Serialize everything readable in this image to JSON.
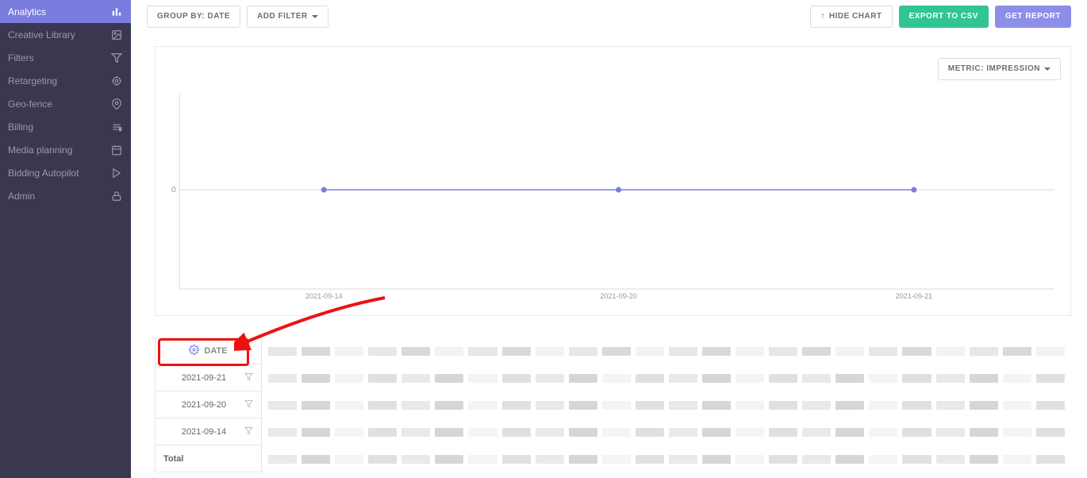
{
  "sidebar": {
    "items": [
      {
        "label": "Analytics",
        "icon": "bar"
      },
      {
        "label": "Creative Library",
        "icon": "image"
      },
      {
        "label": "Filters",
        "icon": "funnel"
      },
      {
        "label": "Retargeting",
        "icon": "target"
      },
      {
        "label": "Geo-fence",
        "icon": "pin"
      },
      {
        "label": "Billing",
        "icon": "money"
      },
      {
        "label": "Media planning",
        "icon": "calendar"
      },
      {
        "label": "Bidding Autopilot",
        "icon": "play"
      },
      {
        "label": "Admin",
        "icon": "lock"
      }
    ],
    "active": 0
  },
  "toolbar": {
    "group_by": "GROUP BY: DATE",
    "add_filter": "ADD FILTER",
    "hide_chart": "HIDE CHART",
    "export_csv": "EXPORT TO CSV",
    "get_report": "GET REPORT"
  },
  "metric_label": "METRIC: IMPRESSION",
  "chart_data": {
    "type": "line",
    "categories": [
      "2021-09-14",
      "2021-09-20",
      "2021-09-21"
    ],
    "values": [
      0,
      0,
      0
    ],
    "ylabel": "",
    "ylim": [
      0,
      0
    ],
    "y_tick": "0"
  },
  "table": {
    "header_date": "DATE",
    "rows": [
      {
        "date": "2021-09-21"
      },
      {
        "date": "2021-09-20"
      },
      {
        "date": "2021-09-14"
      }
    ],
    "total_label": "Total"
  },
  "annotation": {}
}
